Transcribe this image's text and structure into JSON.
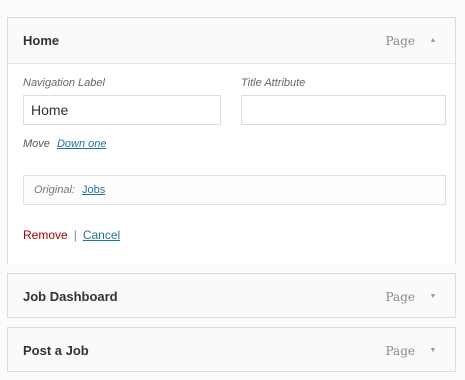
{
  "expanded_item": {
    "title": "Home",
    "type": "Page",
    "nav_label_caption": "Navigation Label",
    "nav_label_value": "Home",
    "title_attr_caption": "Title Attribute",
    "title_attr_value": "",
    "move_caption": "Move",
    "move_link": "Down one",
    "original_caption": "Original:",
    "original_link": "Jobs",
    "remove_label": "Remove",
    "separator": "|",
    "cancel_label": "Cancel",
    "toggle_icon": "arrow-up-icon"
  },
  "collapsed_items": [
    {
      "title": "Job Dashboard",
      "type": "Page",
      "toggle_icon": "arrow-down-icon"
    },
    {
      "title": "Post a Job",
      "type": "Page",
      "toggle_icon": "arrow-down-icon"
    }
  ]
}
